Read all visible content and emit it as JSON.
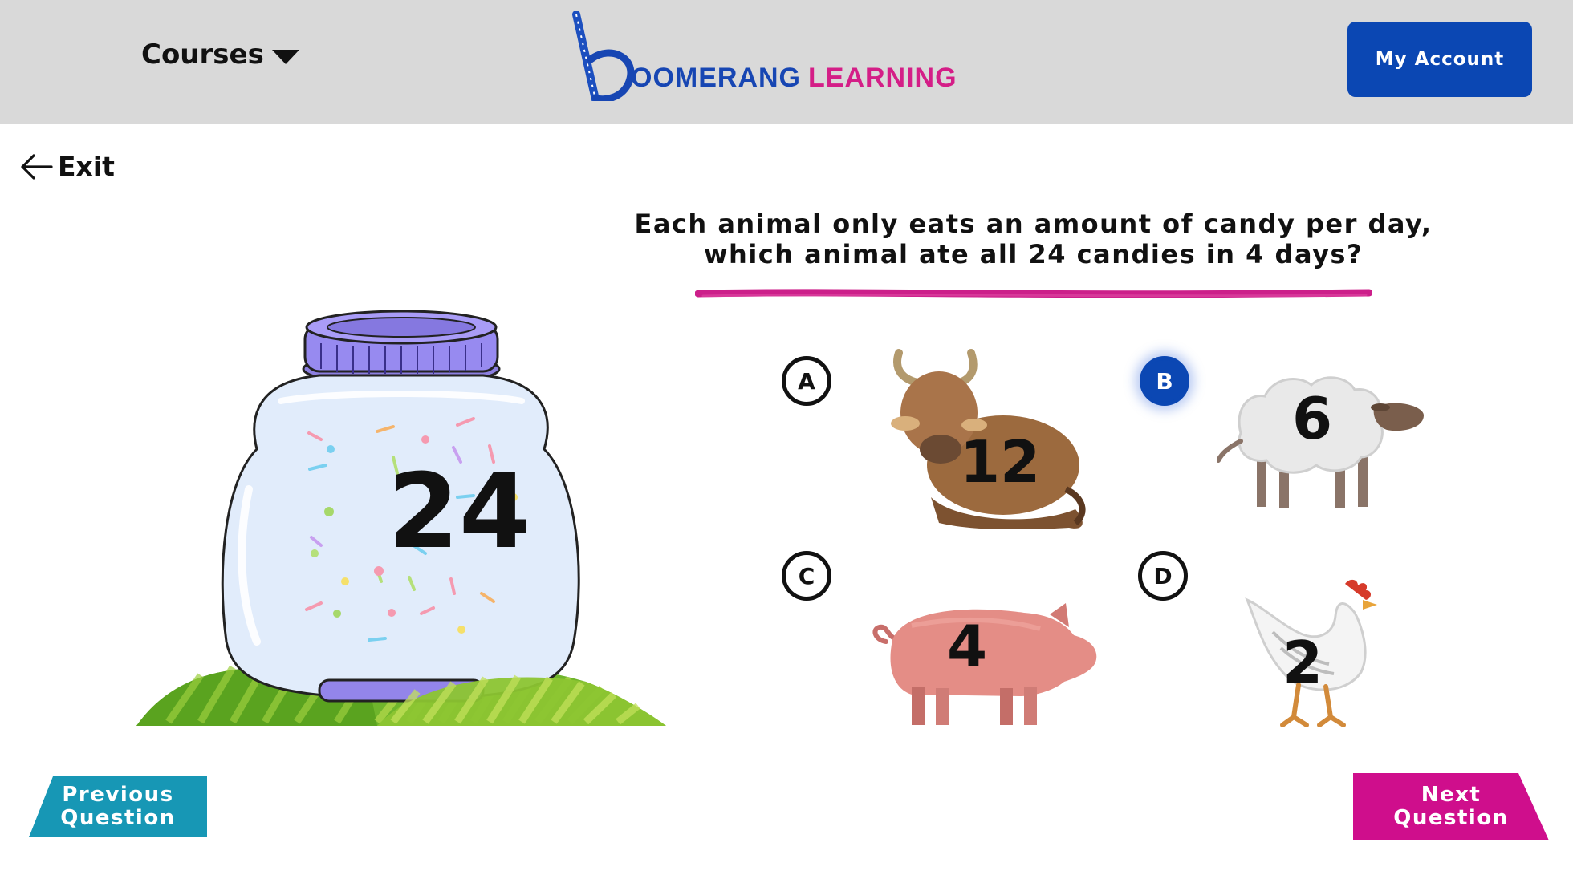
{
  "header": {
    "courses_label": "Courses",
    "logo_text_primary": "OOMERANG",
    "logo_text_secondary": "LEARNING",
    "account_label": "My Account",
    "colors": {
      "background": "#d9d9d9",
      "brand_blue": "#0b47b3",
      "brand_pink": "#d41e87"
    }
  },
  "exit_label": "Exit",
  "question": {
    "text": "Each animal only eats an amount of candy per day, which animal ate all 24 candies in 4 days?"
  },
  "jar": {
    "number": "24"
  },
  "options": [
    {
      "letter": "A",
      "animal": "cow",
      "number": "12",
      "selected": false
    },
    {
      "letter": "B",
      "animal": "sheep",
      "number": "6",
      "selected": true
    },
    {
      "letter": "C",
      "animal": "pig",
      "number": "4",
      "selected": false
    },
    {
      "letter": "D",
      "animal": "chicken",
      "number": "2",
      "selected": false
    }
  ],
  "navigation": {
    "previous_label": "Previous\nQuestion",
    "next_label": "Next\nQuestion",
    "colors": {
      "previous": "#1797b5",
      "next": "#cf0e8c"
    }
  }
}
